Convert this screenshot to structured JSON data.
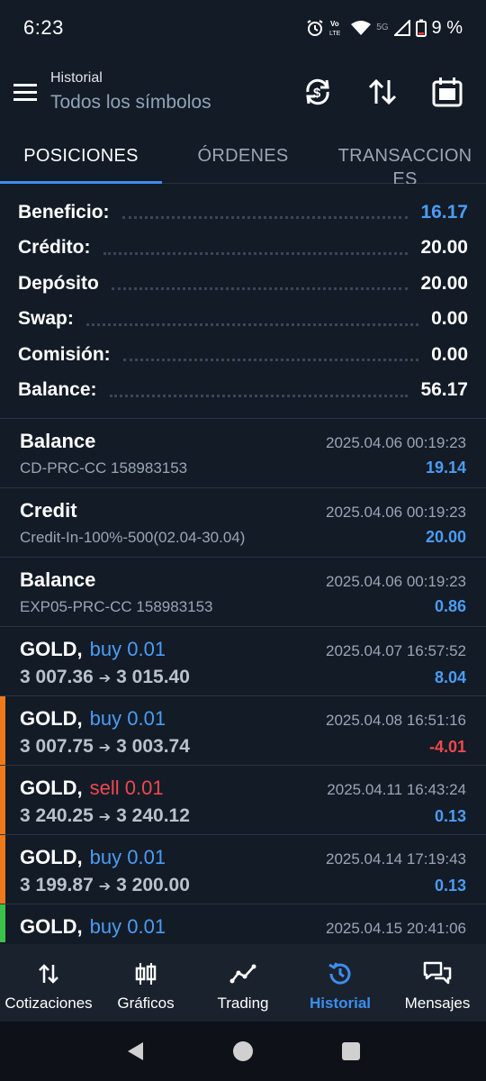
{
  "status": {
    "time": "6:23",
    "network_volte": "Vo LTE",
    "network_5g": "5G",
    "battery": "9 %"
  },
  "header": {
    "title": "Historial",
    "subtitle": "Todos los símbolos"
  },
  "tabs": [
    {
      "label": "POSICIONES",
      "active": true
    },
    {
      "label": "ÓRDENES",
      "active": false
    },
    {
      "label": "TRANSACCIONES",
      "active": false
    }
  ],
  "summary": [
    {
      "label": "Beneficio:",
      "value": "16.17",
      "color": "#4a9cf5"
    },
    {
      "label": "Crédito:",
      "value": "20.00"
    },
    {
      "label": "Depósito",
      "value": "20.00"
    },
    {
      "label": "Swap:",
      "value": "0.00"
    },
    {
      "label": "Comisión:",
      "value": "0.00"
    },
    {
      "label": "Balance:",
      "value": "56.17"
    }
  ],
  "deals": [
    {
      "title": "Balance",
      "time": "2025.04.06 00:19:23",
      "desc": "CD-PRC-CC 158983153",
      "profit": "19.14"
    },
    {
      "title": "Credit",
      "time": "2025.04.06 00:19:23",
      "desc": "Credit-In-100%-500(02.04-30.04)",
      "profit": "20.00"
    },
    {
      "title": "Balance",
      "time": "2025.04.06 00:19:23",
      "desc": "EXP05-PRC-CC 158983153",
      "profit": "0.86"
    },
    {
      "title": "GOLD,",
      "side": "buy 0.01",
      "time": "2025.04.07 16:57:52",
      "open": "3 007.36",
      "close": "3 015.40",
      "profit": "8.04"
    },
    {
      "title": "GOLD,",
      "side": "buy 0.01",
      "time": "2025.04.08 16:51:16",
      "open": "3 007.75",
      "close": "3 003.74",
      "profit": "-4.01",
      "stripe": "#f07a1a"
    },
    {
      "title": "GOLD,",
      "side": "sell 0.01",
      "time": "2025.04.11 16:43:24",
      "open": "3 240.25",
      "close": "3 240.12",
      "profit": "0.13",
      "stripe": "#f07a1a"
    },
    {
      "title": "GOLD,",
      "side": "buy 0.01",
      "time": "2025.04.14 17:19:43",
      "open": "3 199.87",
      "close": "3 200.00",
      "profit": "0.13",
      "stripe": "#f07a1a"
    },
    {
      "title": "GOLD,",
      "side": "buy 0.01",
      "time": "2025.04.15 20:41:06",
      "stripe": "#3cc24a"
    }
  ],
  "bottom_nav": [
    {
      "label": "Cotizaciones",
      "icon": "quotes-icon"
    },
    {
      "label": "Gráficos",
      "icon": "charts-icon"
    },
    {
      "label": "Trading",
      "icon": "trading-icon"
    },
    {
      "label": "Historial",
      "icon": "history-icon",
      "active": true
    },
    {
      "label": "Mensajes",
      "icon": "messages-icon"
    }
  ],
  "colors": {
    "background": "#131b26",
    "accent": "#3c8ef0",
    "profit_positive": "#4a9cf5",
    "profit_negative": "#f0484f",
    "stripe_orange": "#f07a1a",
    "stripe_green": "#3cc24a"
  }
}
